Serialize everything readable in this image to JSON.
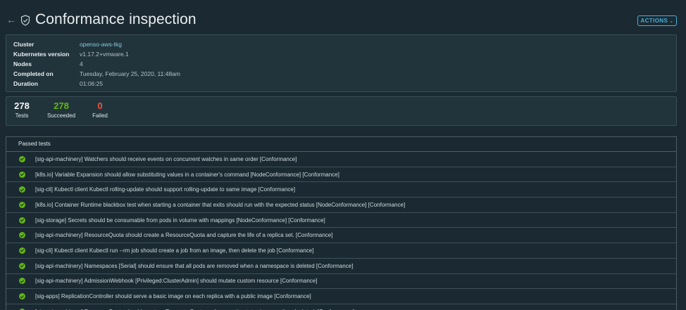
{
  "header": {
    "title": "Conformance inspection",
    "actions_label": "ACTIONS",
    "back_icon": "arrow-left-icon",
    "shield_icon": "shield-check-icon"
  },
  "summary": {
    "cluster_label": "Cluster",
    "cluster_value": "openso-aws-tkg",
    "k8s_label": "Kubernetes version",
    "k8s_value": "v1.17.2+vmware.1",
    "nodes_label": "Nodes",
    "nodes_value": "4",
    "completed_label": "Completed on",
    "completed_value": "Tuesday, February 25, 2020, 11:48am",
    "duration_label": "Duration",
    "duration_value": "01:06:25"
  },
  "stats": {
    "total": "278",
    "total_label": "Tests",
    "succeeded": "278",
    "succeeded_label": "Succeeded",
    "failed": "0",
    "failed_label": "Failed"
  },
  "passed_tests": {
    "header": "Passed tests",
    "items": [
      "[sig-api-machinery] Watchers should receive events on concurrent watches in same order [Conformance]",
      "[k8s.io] Variable Expansion should allow substituting values in a container's command [NodeConformance] [Conformance]",
      "[sig-cli] Kubectl client Kubectl rolling-update should support rolling-update to same image [Conformance]",
      "[k8s.io] Container Runtime blackbox test when starting a container that exits should run with the expected status [NodeConformance] [Conformance]",
      "[sig-storage] Secrets should be consumable from pods in volume with mappings [NodeConformance] [Conformance]",
      "[sig-api-machinery] ResourceQuota should create a ResourceQuota and capture the life of a replica set. [Conformance]",
      "[sig-cli] Kubectl client Kubectl run --rm job should create a job from an image, then delete the job [Conformance]",
      "[sig-api-machinery] Namespaces [Serial] should ensure that all pods are removed when a namespace is deleted [Conformance]",
      "[sig-api-machinery] AdmissionWebhook [Privileged:ClusterAdmin] should mutate custom resource [Conformance]",
      "[sig-apps] ReplicationController should serve a basic image on each replica with a public image [Conformance]",
      "[sig-api-machinery] ResourceQuota should create a ResourceQuota and ensure its status is promptly calculated. [Conformance]"
    ]
  }
}
